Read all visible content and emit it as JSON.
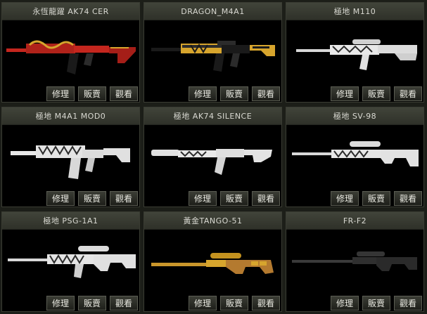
{
  "buttons": {
    "repair": "修理",
    "sell": "販賣",
    "view": "觀看"
  },
  "weapons": [
    {
      "name": "永恆龍躍 AK74 CER",
      "icon": "ak74-rifle-icon"
    },
    {
      "name": "DRAGON_M4A1",
      "icon": "m4a1-rifle-icon"
    },
    {
      "name": "極地 M110",
      "icon": "m110-sniper-icon"
    },
    {
      "name": "極地 M4A1 MOD0",
      "icon": "m4a1-rifle-icon"
    },
    {
      "name": "極地 AK74 SILENCE",
      "icon": "ak74-silenced-icon"
    },
    {
      "name": "極地 SV-98",
      "icon": "sv98-sniper-icon"
    },
    {
      "name": "極地 PSG-1A1",
      "icon": "psg1-sniper-icon"
    },
    {
      "name": "黃金TANGO-51",
      "icon": "tango51-sniper-icon"
    },
    {
      "name": "FR-F2",
      "icon": "frf2-sniper-icon"
    }
  ],
  "colors": {
    "red": "#c4261e",
    "gold": "#d7a52d",
    "snow": "#e8e8e8",
    "dark": "#2b2b2b",
    "wood": "#b47a2f"
  }
}
